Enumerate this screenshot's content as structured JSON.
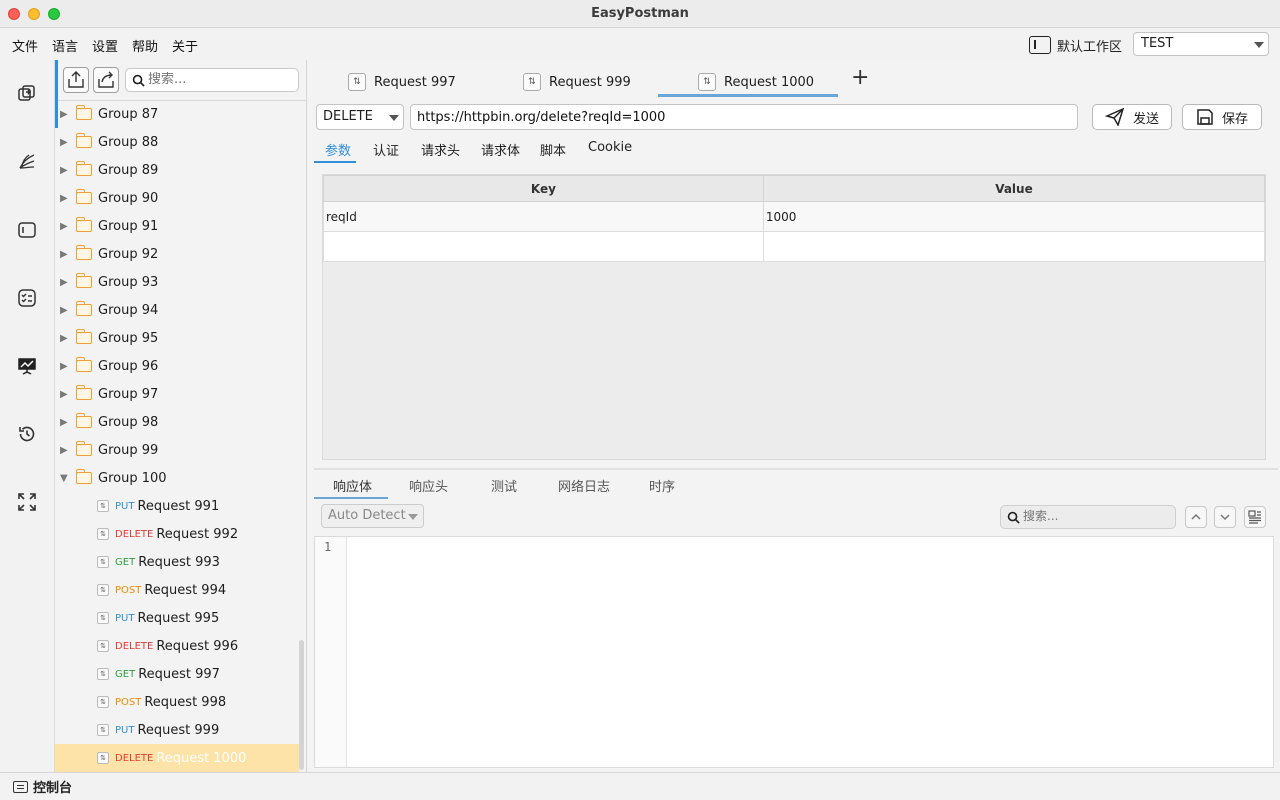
{
  "window": {
    "title": "EasyPostman"
  },
  "menu": {
    "items": [
      "文件",
      "语言",
      "设置",
      "帮助",
      "关于"
    ]
  },
  "workspace": {
    "label": "默认工作区"
  },
  "environment": {
    "selected": "TEST"
  },
  "rail": {
    "icons": [
      "collections-icon",
      "workflow-icon",
      "workspace-icon",
      "functional-test-icon",
      "performance-icon",
      "history-icon",
      "fullscreen-icon"
    ]
  },
  "tree": {
    "search_placeholder": "搜索...",
    "groups": [
      "Group 87",
      "Group 88",
      "Group 89",
      "Group 90",
      "Group 91",
      "Group 92",
      "Group 93",
      "Group 94",
      "Group 95",
      "Group 96",
      "Group 97",
      "Group 98",
      "Group 99",
      "Group 100"
    ],
    "requests": [
      {
        "method": "PUT",
        "name": "Request 991"
      },
      {
        "method": "DELETE",
        "name": "Request 992"
      },
      {
        "method": "GET",
        "name": "Request 993"
      },
      {
        "method": "POST",
        "name": "Request 994"
      },
      {
        "method": "PUT",
        "name": "Request 995"
      },
      {
        "method": "DELETE",
        "name": "Request 996"
      },
      {
        "method": "GET",
        "name": "Request 997"
      },
      {
        "method": "POST",
        "name": "Request 998"
      },
      {
        "method": "PUT",
        "name": "Request 999"
      },
      {
        "method": "DELETE",
        "name": "Request 1000"
      }
    ],
    "selected": "Request 1000",
    "method_colors": {
      "PUT": "#2f8fd8",
      "DELETE": "#e53935",
      "GET": "#2e9e3e",
      "POST": "#f08c00"
    }
  },
  "tabs": [
    "Request 997",
    "Request 999",
    "Request 1000"
  ],
  "active_tab": "Request 1000",
  "request": {
    "method": "DELETE",
    "url": "https://httpbin.org/delete?reqId=1000",
    "send_label": "发送",
    "save_label": "保存"
  },
  "sub_tabs": [
    "参数",
    "认证",
    "请求头",
    "请求体",
    "脚本",
    "Cookie"
  ],
  "params": {
    "headers": [
      "Key",
      "Value"
    ],
    "rows": [
      {
        "key": "reqId",
        "value": "1000"
      }
    ]
  },
  "response": {
    "tabs": [
      "响应体",
      "响应头",
      "测试",
      "网络日志",
      "时序"
    ],
    "format": "Auto Detect",
    "search_placeholder": "搜索...",
    "line_numbers": [
      "1"
    ]
  },
  "status": {
    "console_label": "控制台"
  },
  "colors": {
    "accent": "#2f8fd8",
    "selected_row": "#fde3a7"
  }
}
